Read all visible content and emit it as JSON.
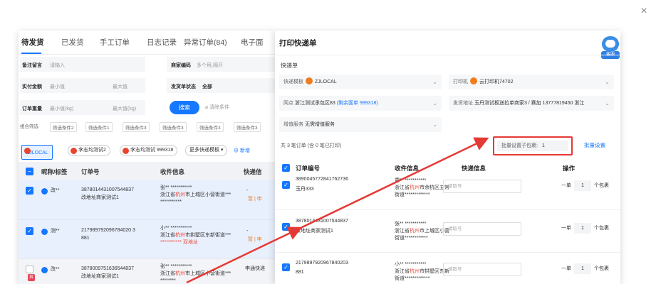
{
  "close_glyph": "×",
  "left": {
    "tabs": [
      "待发货",
      "已发货",
      "手工订单",
      "日志记录",
      "异常订单(84)",
      "电子面"
    ],
    "filters": {
      "remark_label": "备注留言",
      "remark_placeholder": "请输入",
      "goods_code_label": "商家编码",
      "goods_code_placeholder": "多个用,隔开",
      "pay_label": "实付金额",
      "pay_min": "最小值",
      "pay_max": "最大值",
      "ship_status_label": "发货单状态",
      "ship_status_value": "全部",
      "weight_label": "订单重量",
      "weight_min": "最小值(kg)",
      "weight_max": "最大值(kg)",
      "search_button": "搜索",
      "clear_button": "清除条件",
      "combo_label": "组合筛选",
      "conditions": [
        "筛选条件2",
        "筛选条件1",
        "筛选条件3",
        "筛选条件3",
        "筛选条件3",
        "筛选条件3"
      ]
    },
    "chips": [
      "ZJLOCAL",
      "李志均测试2",
      "李志均测试 999318",
      "更多快递模板 ▾"
    ],
    "add_link": "新增",
    "columns": [
      "昵称/标签",
      "订单号",
      "收件信息",
      "快递信"
    ],
    "rows": [
      {
        "nick": "改**",
        "order": "387801443100754483 7",
        "order_display": "3878014431007544837",
        "order_sub": "改地址商家测试1",
        "name": "张** ***********",
        "addr1": "浙江省",
        "addr_city": "杭州",
        "addr2": "市上城区小营街道***",
        "addr3": "***********",
        "extra": "-",
        "extra2": "暂 | 申"
      },
      {
        "nick": "测**",
        "order_display": "217989792096784020 3",
        "order_sub": "881",
        "name": "小** ***********",
        "addr1": "浙江省",
        "addr_city": "杭州",
        "addr2": "市拱墅区东新街道***",
        "addr3": "*********** ",
        "tag": "双地址",
        "extra": "-",
        "extra2": "暂 | 申"
      },
      {
        "nick": "改**",
        "order_display": "3878009751636544837",
        "order_sub": "改地址商家测试1",
        "name": "张** ***********",
        "addr1": "浙江省",
        "addr_city": "杭州",
        "addr2": "市上城区小营街道***",
        "addr3": "********",
        "extra": "申通快递",
        "badge": "异"
      }
    ]
  },
  "dialog": {
    "title": "打印快递单",
    "support_label": "客服",
    "section": "快递单",
    "template_label": "快递模板",
    "template_value": "ZJLOCAL",
    "printer_label": "打印机",
    "printer_value": "云打印机74702",
    "site_label": "网点",
    "site_value": "浙江测试承包区83",
    "site_balance": "(剩余面单 999318)",
    "sender_label": "发货地址",
    "sender_value": "玉丹测试板送拉单商家3 / 赛加 13777819450 浙江",
    "service_label": "增值服务",
    "service_value": "无需增值服务",
    "summary": "共 3 笔订单 (含 0 笔已打印)",
    "batch_label": "批量设置子包裹:",
    "batch_value": "1",
    "batch_button": "批量设置",
    "columns": [
      "订单编号",
      "收件信息",
      "快递信息",
      "操作"
    ],
    "rows": [
      {
        "order": "3890045772841762736",
        "order_sub": "玉丹333",
        "name": "霄** ***********",
        "addr1": "浙江省",
        "addr_city": "杭州",
        "addr2": "市余杭区五常",
        "addr3": "街道*************",
        "placeholder": "请取号",
        "op_prefix": "一单",
        "qty": "1",
        "op_suffix": "个包裹"
      },
      {
        "order": "3878014431007544837",
        "order_sub": "改地址商家测试1",
        "name": "张** ***********",
        "addr1": "浙江省",
        "addr_city": "杭州",
        "addr2": "市上城区小营",
        "addr3": "街道************",
        "placeholder": "请取号",
        "op_prefix": "一单",
        "qty": "1",
        "op_suffix": "个包裹"
      },
      {
        "order": "2179897920967840203",
        "order_sub": "881",
        "name": "小** ***********",
        "addr1": "浙江省",
        "addr_city": "杭州",
        "addr2": "市拱墅区东新",
        "addr3": "街道*************",
        "placeholder": "请取号",
        "op_prefix": "一单",
        "qty": "1",
        "op_suffix": "个包裹"
      }
    ]
  },
  "colors": {
    "accent": "#1677ff",
    "annotation": "#e53935",
    "brand_orange": "#f07d1c"
  }
}
